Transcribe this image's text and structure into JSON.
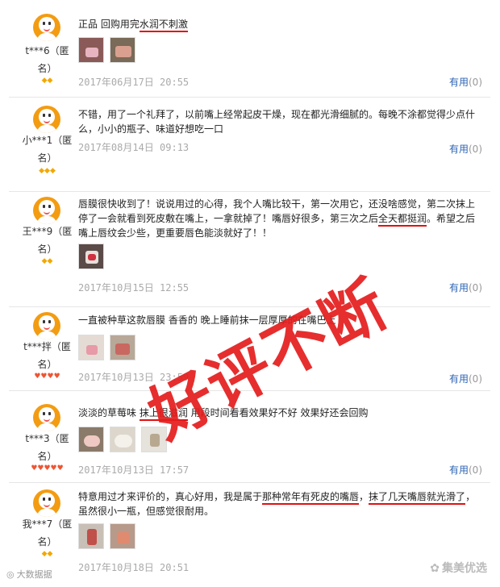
{
  "reviews": [
    {
      "user": "t***6（匿名）",
      "user_line1": "t***6（匿",
      "user_line2": "名）",
      "badge": "◆◆",
      "text": "正品 回购用完水润不刺激",
      "text_pre": "正品 回购用完",
      "text_mark": "水润不刺激",
      "text_post": "",
      "date": "2017年06月17日 20:55",
      "useful_label": "有用",
      "useful_count": "(0)"
    },
    {
      "user_line1": "小***1（匿",
      "user_line2": "名）",
      "badge": "◆◆◆",
      "text": "不错，用了一个礼拜了，以前嘴上经常起皮干燥，现在都光滑细腻的。每晚不涂都觉得少点什么，小小的瓶子、味道好想吃一口",
      "date": "2017年08月14日 09:13",
      "useful_label": "有用",
      "useful_count": "(0)"
    },
    {
      "user_line1": "王***9（匿",
      "user_line2": "名）",
      "badge": "◆◆",
      "text_pre": "唇膜很快收到了！说说用过的心得，我个人嘴比较干，第一次用它，还没啥感觉，第二次抹上停了一会就看到死皮敷在嘴上，一拿就掉了！嘴唇好很多，第三次之后",
      "text_mark": "全天都挺润",
      "text_post": "。希望之后嘴上唇纹会少些，更重要唇色能淡就好了！！",
      "date": "2017年10月15日 12:55",
      "useful_label": "有用",
      "useful_count": "(0)"
    },
    {
      "user_line1": "t***拌（匿",
      "user_line2": "名）",
      "badge": "♥♥♥♥",
      "text": "一直被种草这款唇膜 香香的 晚上睡前抹一层厚厚的在嘴巴上",
      "date": "2017年10月13日 23:59",
      "useful_label": "有用",
      "useful_count": "(0)"
    },
    {
      "user_line1": "t***3（匿",
      "user_line2": "名）",
      "badge": "♥♥♥♥♥",
      "text_pre": "淡淡的草莓味 ",
      "text_mark": "抹上很滋润",
      "text_post": " 用段时间看看效果好不好 效果好还会回购",
      "date": "2017年10月13日 17:57",
      "useful_label": "有用",
      "useful_count": "(0)"
    },
    {
      "user_line1": "我***7（匿",
      "user_line2": "名）",
      "badge": "◆◆",
      "text_pre": "特意用过才来评价的，真心好用，我是属于",
      "text_mark": "那种常年有死皮的嘴唇",
      "text_mid": "，",
      "text_mark2": "抹了几天嘴唇就光滑了",
      "text_post": "，虽然很小一瓶，但感觉很耐用。",
      "date": "2017年10月18日 20:51",
      "useful_label": "",
      "useful_count": ""
    }
  ],
  "stamp": "好评不断",
  "watermark_left": "大数据据",
  "watermark_right": "集美优选",
  "colors": {
    "accent": "#2d64b3",
    "stamp": "#e41d1d",
    "avatar": "#f39c12"
  }
}
